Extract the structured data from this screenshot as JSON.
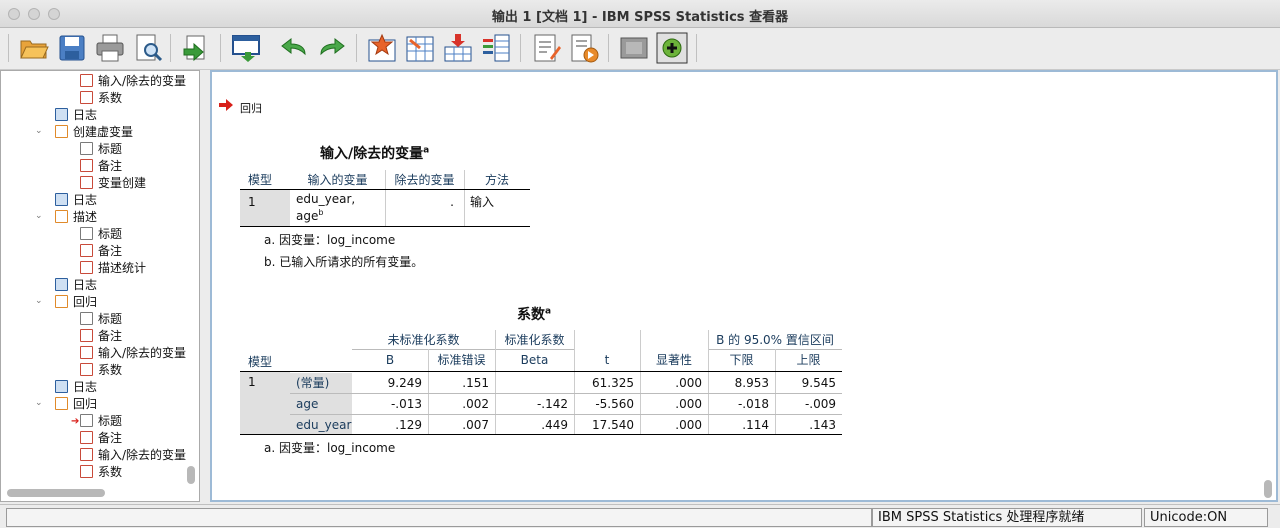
{
  "window": {
    "title": "输出 1 [文档 1] - IBM SPSS Statistics 查看器"
  },
  "toolbar": {
    "buttons": [
      "open-icon",
      "save-icon",
      "print-icon",
      "print-preview-icon",
      "export-icon",
      "recall-dialog-icon",
      "undo-icon",
      "redo-icon",
      "goto-data-icon",
      "goto-case-icon",
      "goto-variable-icon",
      "variables-icon",
      "insert-text-icon",
      "insert-title-icon",
      "hide-icon",
      "zoom-in-icon"
    ]
  },
  "tree": {
    "items": [
      {
        "label": "输入/除去的变量",
        "level": 2,
        "icon": "table-icon"
      },
      {
        "label": "系数",
        "level": 2,
        "icon": "table-icon"
      },
      {
        "label": "日志",
        "level": 1,
        "icon": "log-icon"
      },
      {
        "label": "创建虚变量",
        "level": 1,
        "icon": "procedure-icon",
        "toggle": "⌄"
      },
      {
        "label": "标题",
        "level": 2,
        "icon": "title-icon"
      },
      {
        "label": "备注",
        "level": 2,
        "icon": "notes-icon"
      },
      {
        "label": "变量创建",
        "level": 2,
        "icon": "table-icon"
      },
      {
        "label": "日志",
        "level": 1,
        "icon": "log-icon"
      },
      {
        "label": "描述",
        "level": 1,
        "icon": "procedure-icon",
        "toggle": "⌄"
      },
      {
        "label": "标题",
        "level": 2,
        "icon": "title-icon"
      },
      {
        "label": "备注",
        "level": 2,
        "icon": "notes-icon"
      },
      {
        "label": "描述统计",
        "level": 2,
        "icon": "table-icon"
      },
      {
        "label": "日志",
        "level": 1,
        "icon": "log-icon"
      },
      {
        "label": "回归",
        "level": 1,
        "icon": "procedure-icon",
        "toggle": "⌄"
      },
      {
        "label": "标题",
        "level": 2,
        "icon": "title-icon"
      },
      {
        "label": "备注",
        "level": 2,
        "icon": "notes-icon"
      },
      {
        "label": "输入/除去的变量",
        "level": 2,
        "icon": "table-icon"
      },
      {
        "label": "系数",
        "level": 2,
        "icon": "table-icon"
      },
      {
        "label": "日志",
        "level": 1,
        "icon": "log-icon"
      },
      {
        "label": "回归",
        "level": 1,
        "icon": "procedure-icon",
        "toggle": "⌄"
      },
      {
        "label": "标题",
        "level": 2,
        "icon": "title-icon",
        "current": true
      },
      {
        "label": "备注",
        "level": 2,
        "icon": "notes-icon"
      },
      {
        "label": "输入/除去的变量",
        "level": 2,
        "icon": "table-icon"
      },
      {
        "label": "系数",
        "level": 2,
        "icon": "table-icon"
      }
    ]
  },
  "output": {
    "procedure_title": "回归",
    "table1": {
      "title": "输入/除去的变量",
      "title_sup": "a",
      "headers": [
        "模型",
        "输入的变量",
        "除去的变量",
        "方法"
      ],
      "row": {
        "model": "1",
        "entered_line1": "edu_year,",
        "entered_line2": "age",
        "entered_sup": "b",
        "removed": ".",
        "method": "输入"
      },
      "footnote_a": "a. 因变量：log_income",
      "footnote_b": "b. 已输入所请求的所有变量。"
    },
    "table2": {
      "title": "系数",
      "title_sup": "a",
      "group_unstd": "未标准化系数",
      "group_std": "标准化系数",
      "group_ci": "B 的 95.0% 置信区间",
      "headers": {
        "model": "模型",
        "b": "B",
        "se": "标准错误",
        "beta": "Beta",
        "t": "t",
        "sig": "显著性",
        "lower": "下限",
        "upper": "上限"
      },
      "model_num": "1",
      "rows": [
        {
          "name": "(常量)",
          "b": "9.249",
          "se": ".151",
          "beta": "",
          "t": "61.325",
          "sig": ".000",
          "lower": "8.953",
          "upper": "9.545"
        },
        {
          "name": "age",
          "b": "-.013",
          "se": ".002",
          "beta": "-.142",
          "t": "-5.560",
          "sig": ".000",
          "lower": "-.018",
          "upper": "-.009"
        },
        {
          "name": "edu_year",
          "b": ".129",
          "se": ".007",
          "beta": ".449",
          "t": "17.540",
          "sig": ".000",
          "lower": ".114",
          "upper": ".143"
        }
      ],
      "footnote": "a. 因变量：log_income"
    }
  },
  "status": {
    "message": "IBM SPSS Statistics 处理程序就绪",
    "unicode": "Unicode:ON"
  }
}
